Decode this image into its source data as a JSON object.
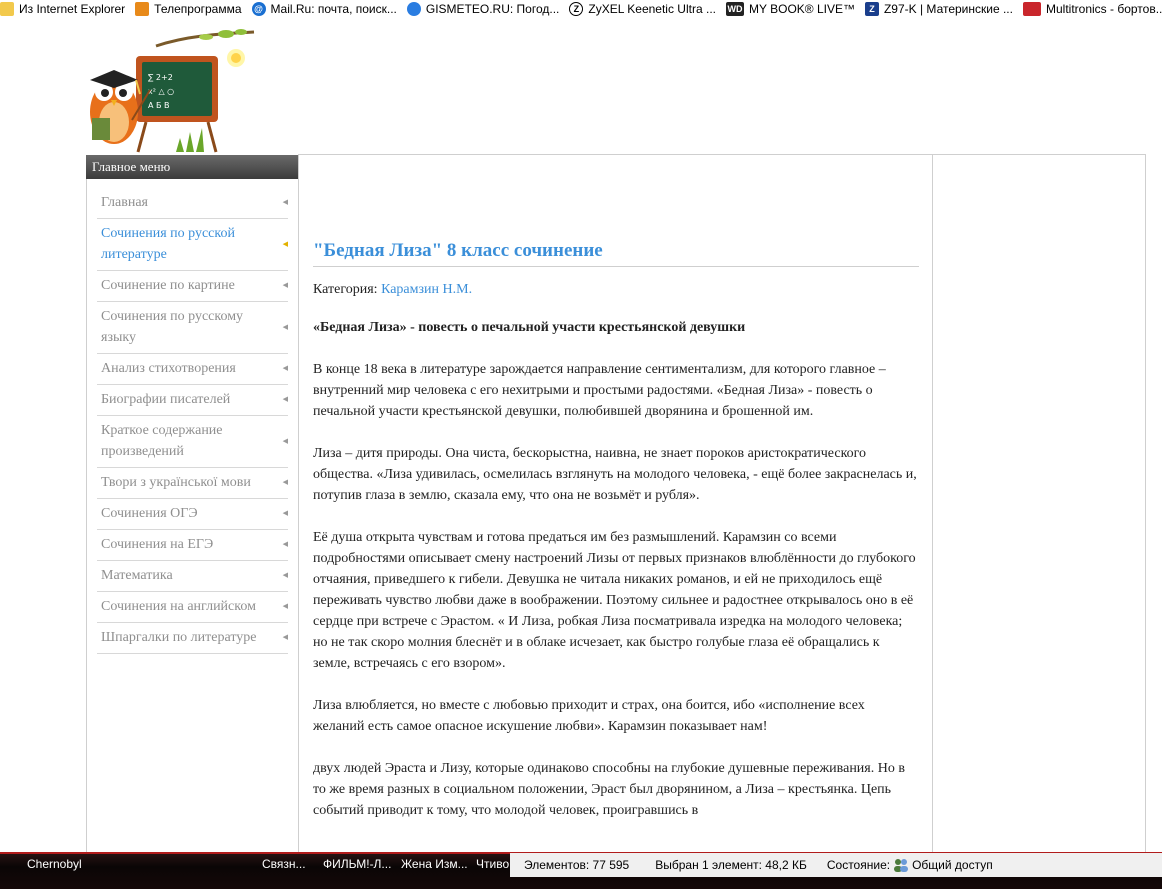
{
  "bookmarks": [
    {
      "label": "Из Internet Explorer",
      "icon": "ie-icon"
    },
    {
      "label": "Телепрограмма",
      "icon": "tv-icon"
    },
    {
      "label": "Mail.Ru: почта, поиск...",
      "icon": "mailru-icon"
    },
    {
      "label": "GISMETEO.RU: Погод...",
      "icon": "gismeteo-icon"
    },
    {
      "label": "ZyXEL Keenetic Ultra ...",
      "icon": "zyxel-icon"
    },
    {
      "label": "MY BOOK® LIVE™",
      "icon": "wd-icon"
    },
    {
      "label": "Z97-K | Материнские ...",
      "icon": "asus-icon"
    },
    {
      "label": "Multitronics - бортов...",
      "icon": "multitronics-icon"
    }
  ],
  "sidebar": {
    "header": "Главное меню",
    "items": [
      {
        "label": "Главная"
      },
      {
        "label": "Сочинения по русской литературе",
        "active": true
      },
      {
        "label": "Сочинение по картине"
      },
      {
        "label": "Сочинения по русскому языку"
      },
      {
        "label": "Анализ стихотворения"
      },
      {
        "label": "Биографии писателей"
      },
      {
        "label": "Краткое содержание произведений"
      },
      {
        "label": "Твори з української мови"
      },
      {
        "label": "Сочинения ОГЭ"
      },
      {
        "label": "Сочинения на ЕГЭ"
      },
      {
        "label": "Математика"
      },
      {
        "label": "Сочинения на английском"
      },
      {
        "label": "Шпаргалки по литературе"
      }
    ]
  },
  "article": {
    "title": "\"Бедная Лиза\" 8 класс сочинение",
    "category_label": "Категория:",
    "category_value": "Карамзин Н.М.",
    "lead": "«Бедная Лиза» - повесть о печальной участи крестьянской девушки",
    "paragraphs": [
      "В конце 18 века в литературе зарождается направление сентиментализм, для которого главное – внутренний мир человека с его нехитрыми и простыми радостями. «Бедная Лиза» - повесть о печальной участи крестьянской девушки, полюбившей дворянина и брошенной им.",
      "Лиза – дитя природы. Она чиста, бескорыстна, наивна, не знает пороков аристократического общества. «Лиза удивилась, осмелилась взглянуть на молодого человека, - ещё более закраснелась и, потупив глаза в землю, сказала ему, что она не возьмёт и рубля».",
      "Её душа открыта чувствам и готова предаться им без размышлений. Карамзин со всеми подробностями описывает смену настроений Лизы от первых признаков влюблённости до глубокого отчаяния, приведшего к гибели. Девушка не читала никаких романов, и ей не приходилось ещё переживать чувство любви даже в воображении. Поэтому сильнее и радостнее открывалось оно в её сердце при встрече с Эрастом. « И Лиза, робкая Лиза посматривала изредка на молодого человека; но не так скоро молния блеснёт и в облаке исчезает, как быстро голубые глаза её обращались к земле, встречаясь с его взором».",
      "Лиза влюбляется, но вместе с любовью приходит и страх, она боится, ибо «исполнение всех желаний есть самое опасное искушение любви». Карамзин показывает нам!",
      "двух людей Эраста и Лизу, которые одинаково способны на глубокие душевные переживания. Но в то же время разных в социальном положении, Эраст был дворянином, а Лиза – крестьянка. Цепь событий приводит к тому, что молодой человек, проигравшись в"
    ]
  },
  "taskbar": {
    "items": [
      "Chernobyl",
      "Связн...",
      "ФИЛЬМ!-Л...",
      "Жена Изм...",
      "Чтиво"
    ]
  },
  "statusbar": {
    "elements": "Элементов: 77 595",
    "selected": "Выбран 1 элемент: 48,2 КБ",
    "state_label": "Состояние:",
    "state_value": "Общий доступ"
  },
  "colors": {
    "link": "#3b8fd9",
    "menu_text": "#8f8f8f",
    "taskbar_accent": "#b11c1c"
  }
}
